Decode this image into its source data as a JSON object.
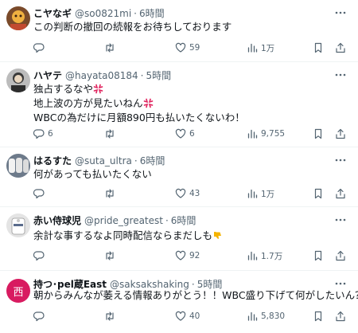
{
  "tweets": [
    {
      "name": "こヤなギ",
      "handle": "@so0821mi",
      "time": "6時間",
      "lines": [
        "この判断の撤回の続報をお待ちしております"
      ],
      "reply_count": "",
      "like_count": "59",
      "view_count": "1万"
    },
    {
      "name": "ハヤテ",
      "handle": "@hayata08184",
      "time": "5時間",
      "lines": [
        "独占するなや",
        "地上波の方が見たいねん",
        "WBCの為だけに月額890円も払いたくないわ！"
      ],
      "reply_count": "6",
      "like_count": "6",
      "view_count": "9,755"
    },
    {
      "name": "はるすた",
      "handle": "@suta_ultra",
      "time": "6時間",
      "lines": [
        "何があっても払いたくない"
      ],
      "reply_count": "",
      "like_count": "43",
      "view_count": "1万"
    },
    {
      "name": "赤い侍球児",
      "handle": "@pride_greatest",
      "time": "6時間",
      "lines": [
        "余計な事するなよ同時配信ならまだしも"
      ],
      "reply_count": "",
      "like_count": "92",
      "view_count": "1.7万"
    },
    {
      "name": "持つ･pel蔵East",
      "handle": "@saksakshaking",
      "time": "5時間",
      "avatar_text": "西",
      "lines": [
        "朝からみんなが萎える情報ありがとう！！WBC盛り下げて何がしたいん？"
      ],
      "reply_count": "",
      "like_count": "40",
      "view_count": "5,830"
    }
  ],
  "separator": "·",
  "icons": [
    "reply-icon",
    "retweet-icon",
    "like-icon",
    "views-icon",
    "bookmark-icon",
    "share-icon",
    "more-icon"
  ],
  "colors": {
    "text": "#0f1419",
    "muted": "#536471",
    "divider": "#eff3f4",
    "avatar_red": "#d81b60"
  }
}
